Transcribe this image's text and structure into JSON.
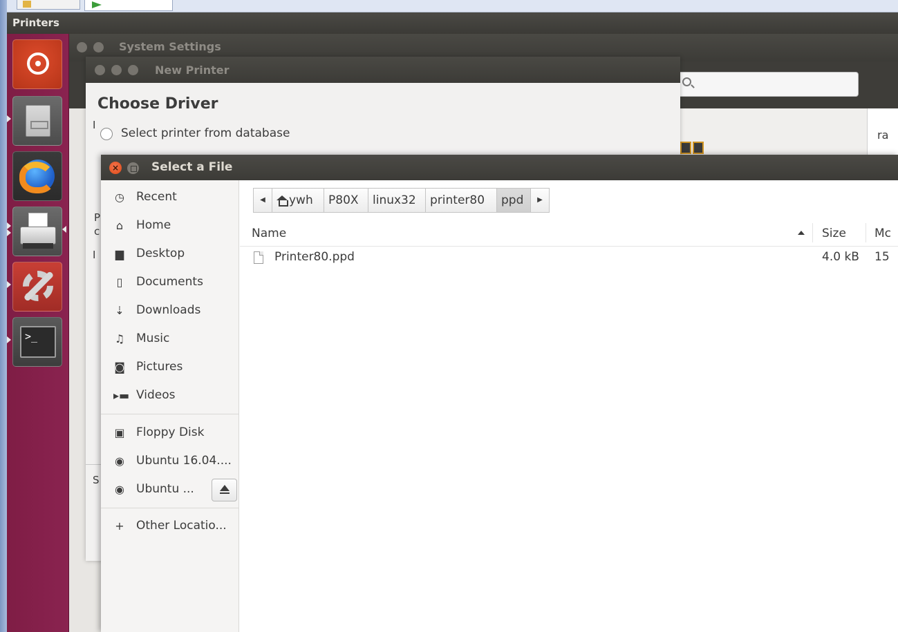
{
  "top_panel": {
    "title": "Printers"
  },
  "system_settings": {
    "title": "System Settings",
    "right_text": "ra"
  },
  "new_printer": {
    "title": "New Printer",
    "heading": "Choose Driver",
    "radio_database_label": "Select printer from database",
    "stub_letters": [
      "I",
      "P",
      "c",
      "I",
      "S"
    ]
  },
  "file_chooser": {
    "title": "Select a File",
    "sidebar": {
      "places": [
        {
          "label": "Recent",
          "icon": "clock-icon"
        },
        {
          "label": "Home",
          "icon": "home-icon"
        },
        {
          "label": "Desktop",
          "icon": "folder-icon"
        },
        {
          "label": "Documents",
          "icon": "document-icon"
        },
        {
          "label": "Downloads",
          "icon": "download-icon"
        },
        {
          "label": "Music",
          "icon": "music-icon"
        },
        {
          "label": "Pictures",
          "icon": "camera-icon"
        },
        {
          "label": "Videos",
          "icon": "video-icon"
        }
      ],
      "devices": [
        {
          "label": "Floppy Disk",
          "icon": "floppy-icon"
        },
        {
          "label": "Ubuntu 16.04....",
          "icon": "disc-icon"
        },
        {
          "label": "Ubuntu ...",
          "icon": "disc-icon"
        }
      ],
      "other_locations": {
        "label": "Other Locatio...",
        "icon": "plus-icon"
      }
    },
    "pathbar": {
      "home_segment": "ywh",
      "segments": [
        "P80X",
        "linux32",
        "printer80",
        "ppd"
      ]
    },
    "columns": {
      "name": "Name",
      "size": "Size",
      "modified": "Mc"
    },
    "files": [
      {
        "name": "Printer80.ppd",
        "size": "4.0 kB",
        "modified": "15"
      }
    ]
  }
}
